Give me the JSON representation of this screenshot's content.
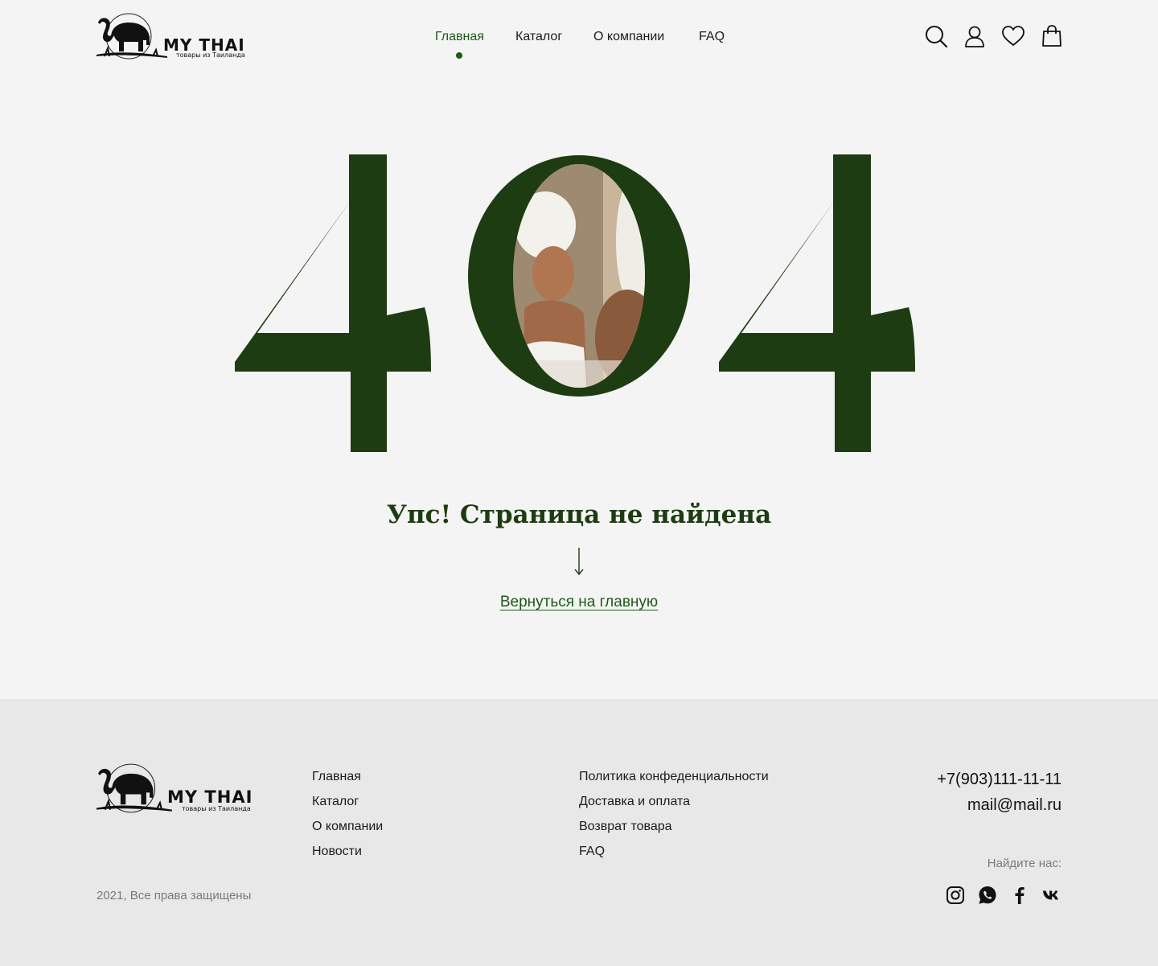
{
  "header": {
    "logo": {
      "brand": "MY THAI",
      "tagline": "товары из Таиланда"
    },
    "nav": [
      {
        "label": "Главная",
        "active": true
      },
      {
        "label": "Каталог",
        "active": false
      },
      {
        "label": "О компании",
        "active": false
      },
      {
        "label": "FAQ",
        "active": false
      }
    ],
    "icons": [
      "search-icon",
      "user-icon",
      "heart-icon",
      "cart-icon"
    ]
  },
  "error": {
    "code": "404",
    "title": "Упс! Страница не найдена",
    "link_label": "Вернуться на главную"
  },
  "footer": {
    "logo": {
      "brand": "MY THAI",
      "tagline": "товары из Таиланда"
    },
    "menu": [
      "Главная",
      "Каталог",
      "О компании",
      "Новости"
    ],
    "info": [
      "Политика конфеденциальности",
      "Доставка и оплата",
      "Возврат товара",
      "FAQ"
    ],
    "phone": "+7(903)111-11-11",
    "email": "mail@mail.ru",
    "find_us": "Найдите нас:",
    "socials": [
      "instagram-icon",
      "whatsapp-icon",
      "facebook-icon",
      "vk-icon"
    ],
    "copyright": "2021, Все права защищены"
  },
  "colors": {
    "accent": "#1d5a17",
    "digits": "#1e3c12",
    "page_bg": "#f4f4f4",
    "footer_bg": "#e8e8e8"
  }
}
